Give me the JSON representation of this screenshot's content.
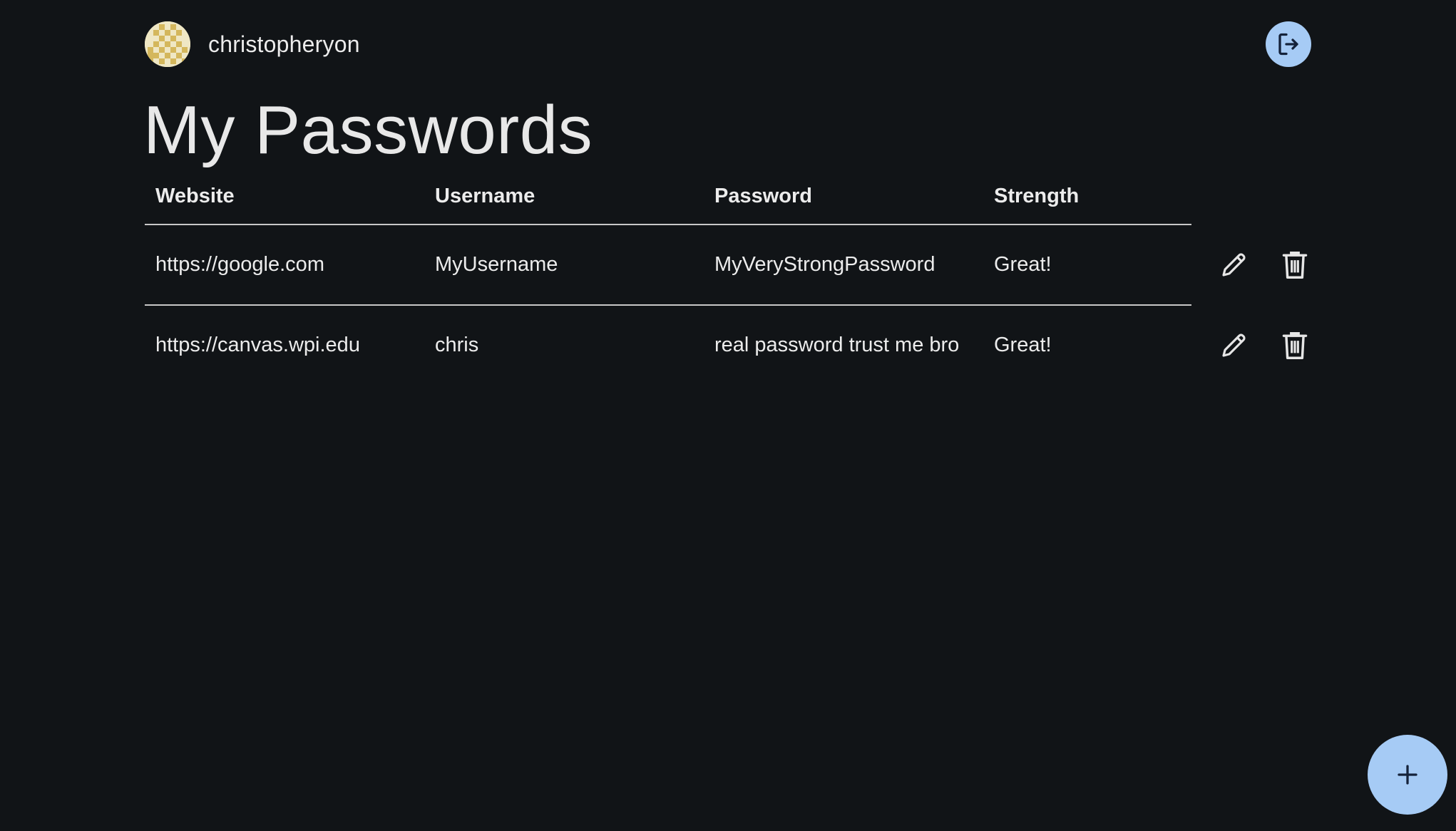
{
  "user": {
    "username": "christopheryon"
  },
  "page": {
    "title": "My Passwords"
  },
  "table": {
    "headers": [
      "Website",
      "Username",
      "Password",
      "Strength"
    ],
    "rows": [
      {
        "website": "https://google.com",
        "username": "MyUsername",
        "password": "MyVeryStrongPassword",
        "strength": "Great!"
      },
      {
        "website": "https://canvas.wpi.edu",
        "username": "chris",
        "password": "real password trust me bro",
        "strength": "Great!"
      }
    ]
  },
  "icons": {
    "avatar": "checkered-avatar",
    "logout": "logout-icon",
    "edit": "pencil-icon",
    "delete": "trash-icon",
    "add": "plus-icon"
  },
  "colors": {
    "background": "#111417",
    "accent": "#a6cbf5",
    "text": "#ececec",
    "divider": "#c8c8c8",
    "avatar_gold": "#d4b75c",
    "avatar_light": "#efe7c4"
  }
}
